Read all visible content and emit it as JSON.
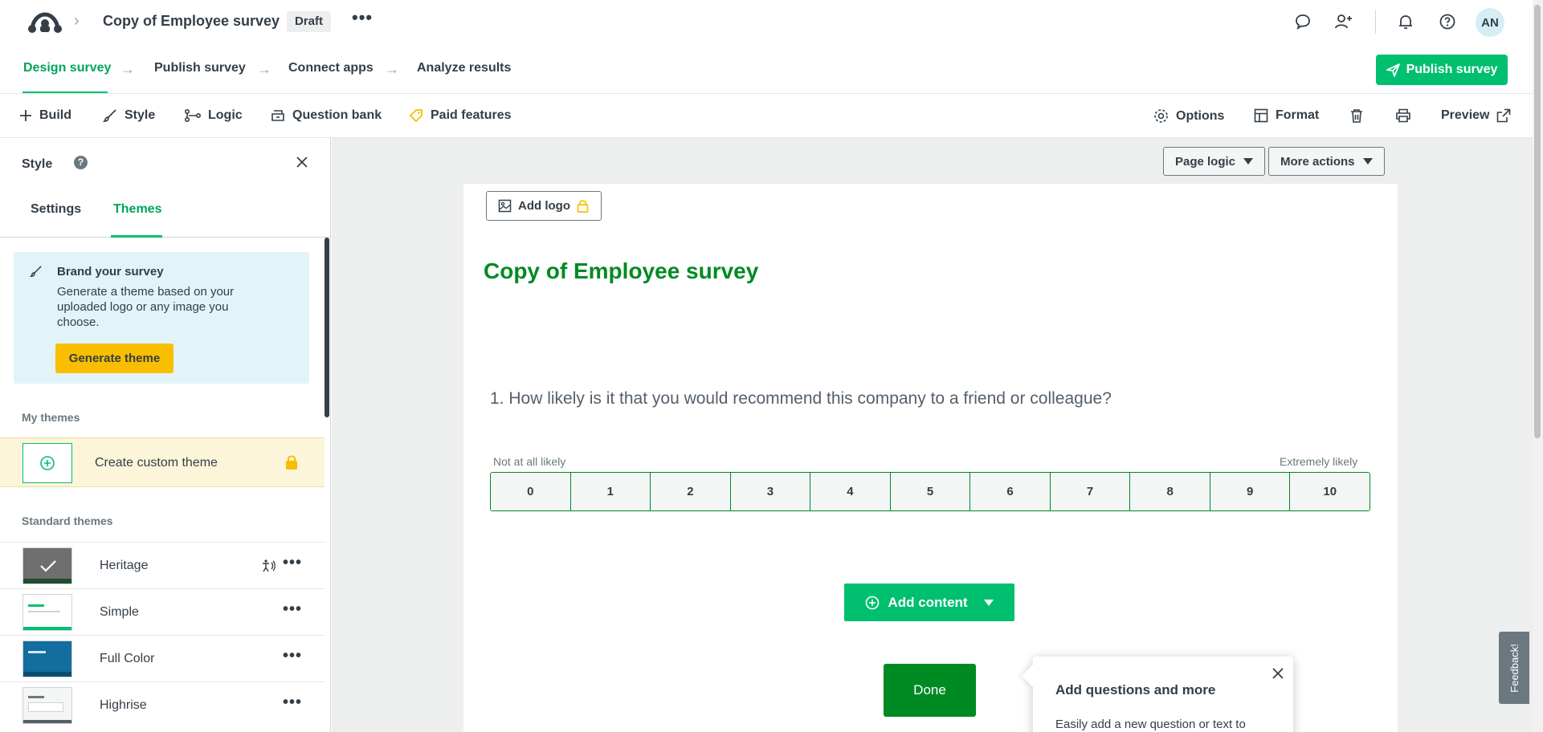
{
  "topbar": {
    "survey_title": "Copy of Employee survey",
    "status_badge": "Draft",
    "more_label": "•••",
    "avatar_initials": "AN"
  },
  "steps": {
    "items": [
      "Design survey",
      "Publish survey",
      "Connect apps",
      "Analyze results"
    ],
    "active": "Design survey",
    "publish_button": "Publish survey"
  },
  "toolbar": {
    "left": [
      "Build",
      "Style",
      "Logic",
      "Question bank",
      "Paid features"
    ],
    "right": [
      "Options",
      "Format",
      "Preview"
    ]
  },
  "panel": {
    "title": "Style",
    "tabs": [
      "Settings",
      "Themes"
    ],
    "active_tab": "Themes",
    "brand": {
      "title": "Brand your survey",
      "description": "Generate a theme based on your uploaded logo or any image you choose.",
      "button": "Generate theme"
    },
    "my_themes_label": "My themes",
    "create_custom_label": "Create custom theme",
    "standard_themes_label": "Standard themes",
    "themes": [
      {
        "name": "Heritage",
        "selected": true
      },
      {
        "name": "Simple",
        "selected": false
      },
      {
        "name": "Full Color",
        "selected": false
      },
      {
        "name": "Highrise",
        "selected": false
      }
    ],
    "theme_more_label": "•••"
  },
  "canvas": {
    "page_logic": "Page logic",
    "more_actions": "More actions",
    "add_logo": "Add logo",
    "heading": "Copy of Employee survey",
    "question": "1. How likely is it that you would recommend this company to a friend or colleague?",
    "scale_low_label": "Not at all likely",
    "scale_high_label": "Extremely likely",
    "scale_values": [
      "0",
      "1",
      "2",
      "3",
      "4",
      "5",
      "6",
      "7",
      "8",
      "9",
      "10"
    ],
    "add_content": "Add content",
    "done": "Done"
  },
  "popover": {
    "title": "Add questions and more",
    "text": "Easily add a new question or text to"
  },
  "feedback_label": "Feedback!",
  "colors": {
    "brand_green": "#00bf6f",
    "heading_green": "#008a24",
    "accent_yellow": "#f9be00",
    "brand_card_bg": "#e2f4f7"
  }
}
